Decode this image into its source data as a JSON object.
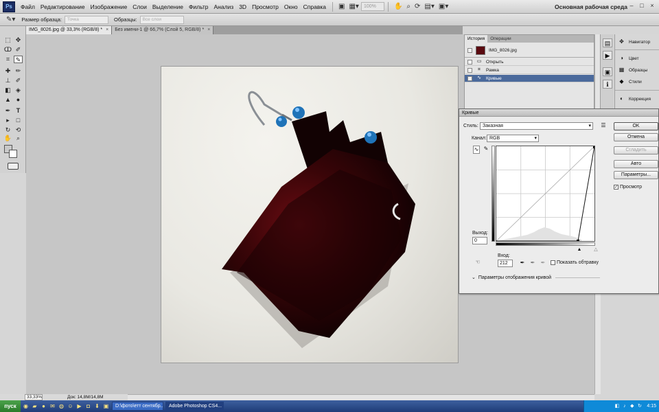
{
  "app": {
    "logo": "Ps",
    "workspace_label": "Основная рабочая среда"
  },
  "menu": [
    "Файл",
    "Редактирование",
    "Изображение",
    "Слои",
    "Выделение",
    "Фильтр",
    "Анализ",
    "3D",
    "Просмотр",
    "Окно",
    "Справка"
  ],
  "menubar_zoom": "100%",
  "window_controls": {
    "min": "–",
    "max": "□",
    "close": "×"
  },
  "options": {
    "sample_size_label": "Размер образца:",
    "sample_size_value": "Точка",
    "sample_label": "Образцы:",
    "sample_value": "Все слои"
  },
  "doc_tabs": [
    {
      "label": "IMG_8026.jpg @ 33,3% (RGB/8) *",
      "close": "×",
      "active": true
    },
    {
      "label": "Без имени-1 @ 66,7% (Слой 5, RGB/8) *",
      "close": "×",
      "active": false
    }
  ],
  "status": {
    "zoom": "33,33%",
    "doc": "Док: 14,8M/14,8M"
  },
  "history": {
    "tabs": [
      "История",
      "Операции"
    ],
    "snapshot": "IMG_8026.jpg",
    "steps": [
      "Открыть",
      "Рамка",
      "Кривые"
    ]
  },
  "dock": {
    "items": [
      "Навигатор",
      "Цвет",
      "Образцы",
      "Стили",
      "Коррекция"
    ]
  },
  "curves": {
    "title": "Кривые",
    "style_label": "Стиль:",
    "style_value": "Заказная",
    "channel_label": "Канал:",
    "channel_value": "RGB",
    "output_label": "Выход:",
    "output_value": "0",
    "input_label": "Вход:",
    "input_value": "212",
    "show_clipping": "Показать обтравку",
    "curve_options": "Параметры отображения кривой",
    "buttons": {
      "ok": "OK",
      "cancel": "Отмена",
      "smooth": "Сгладить",
      "auto": "Авто",
      "params": "Параметры..."
    },
    "preview_label": "Просмотр",
    "preview_checked": true
  },
  "taskbar": {
    "start": "пуск",
    "tasks": [
      {
        "label": "D:\\фото\\етт сентябр...",
        "active": false
      },
      {
        "label": "Adobe Photoshop CS4...",
        "active": true
      }
    ],
    "clock": "4:15"
  }
}
